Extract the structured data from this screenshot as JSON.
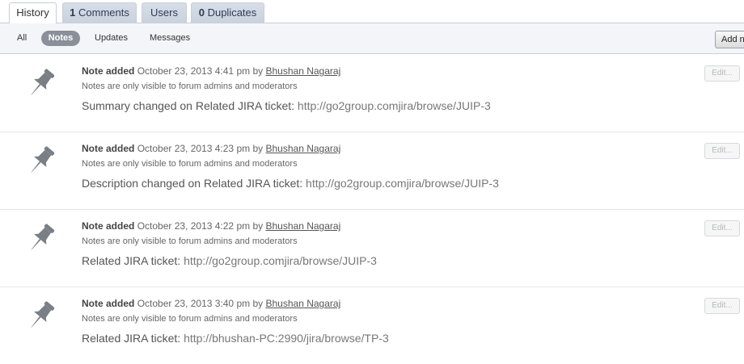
{
  "tabs": [
    {
      "count": "",
      "label": "History"
    },
    {
      "count": "1",
      "label": "Comments"
    },
    {
      "count": "",
      "label": "Users"
    },
    {
      "count": "0",
      "label": "Duplicates"
    }
  ],
  "filters": [
    "All",
    "Notes",
    "Updates",
    "Messages"
  ],
  "add_button_label": "Add n",
  "entries": [
    {
      "kind": "Note added",
      "date": "October 23, 2013 4:41 pm",
      "by": "by",
      "author": "Bhushan Nagaraj",
      "visibility": "Notes are only visible to forum admins and moderators",
      "text": "Summary changed on Related JIRA ticket:",
      "link": "http://go2group.comjira/browse/JUIP-3",
      "edit_label": "Edit..."
    },
    {
      "kind": "Note added",
      "date": "October 23, 2013 4:23 pm",
      "by": "by",
      "author": "Bhushan Nagaraj",
      "visibility": "Notes are only visible to forum admins and moderators",
      "text": "Description changed on Related JIRA ticket:",
      "link": "http://go2group.comjira/browse/JUIP-3",
      "edit_label": "Edit..."
    },
    {
      "kind": "Note added",
      "date": "October 23, 2013 4:22 pm",
      "by": "by",
      "author": "Bhushan Nagaraj",
      "visibility": "Notes are only visible to forum admins and moderators",
      "text": "Related JIRA ticket:",
      "link": "http://go2group.comjira/browse/JUIP-3",
      "edit_label": "Edit..."
    },
    {
      "kind": "Note added",
      "date": "October 23, 2013 3:40 pm",
      "by": "by",
      "author": "Bhushan Nagaraj",
      "visibility": "Notes are only visible to forum admins and moderators",
      "text": "Related JIRA ticket:",
      "link": "http://bhushan-PC:2990/jira/browse/TP-3",
      "edit_label": "Edit..."
    }
  ]
}
